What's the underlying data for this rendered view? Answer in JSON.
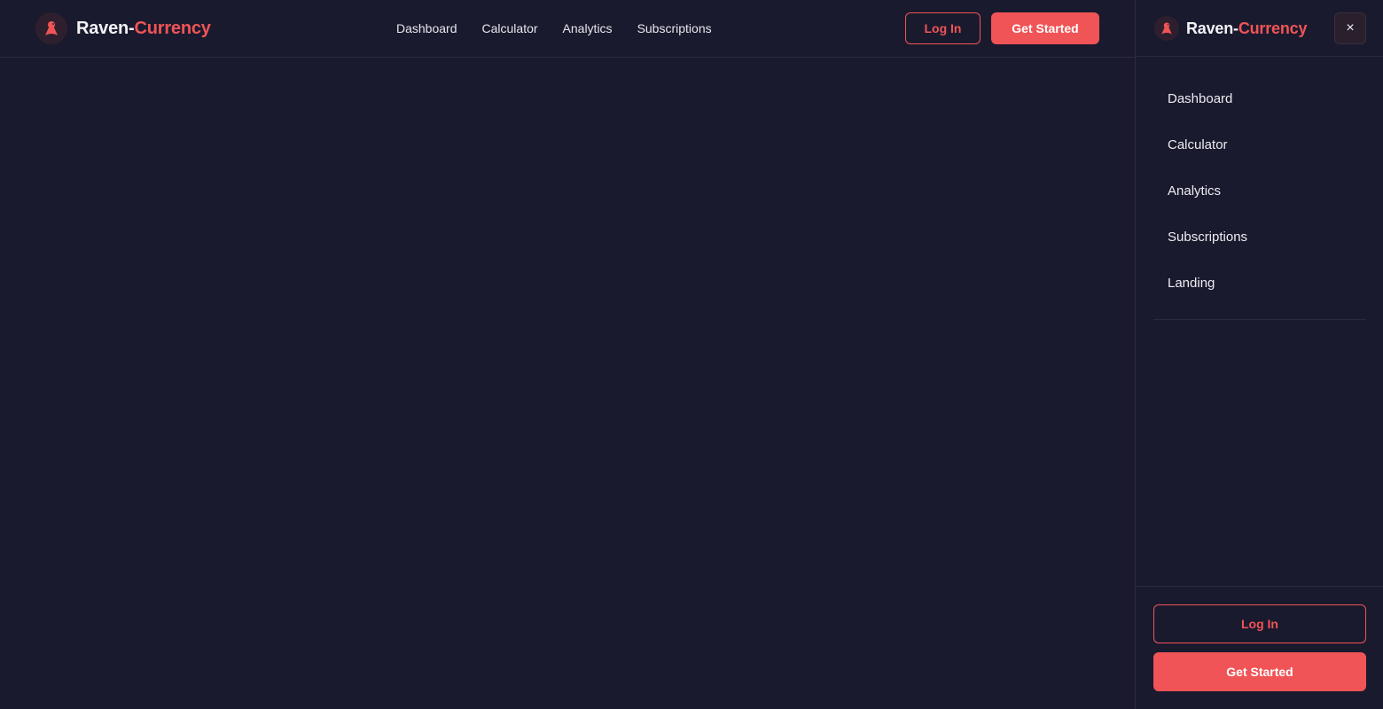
{
  "brand": {
    "name_part1": "Raven-",
    "name_part2": "Currency"
  },
  "colors": {
    "background": "#1a1a2e",
    "accent": "#f05456",
    "text": "#e8e8ee"
  },
  "header": {
    "nav": [
      "Dashboard",
      "Calculator",
      "Analytics",
      "Subscriptions"
    ],
    "login_label": "Log In",
    "get_started_label": "Get Started"
  },
  "drawer": {
    "close_icon": "×",
    "nav": [
      "Dashboard",
      "Calculator",
      "Analytics",
      "Subscriptions",
      "Landing"
    ],
    "login_label": "Log In",
    "get_started_label": "Get Started"
  },
  "icons": {
    "logo": "raven-icon",
    "close": "close-icon"
  }
}
